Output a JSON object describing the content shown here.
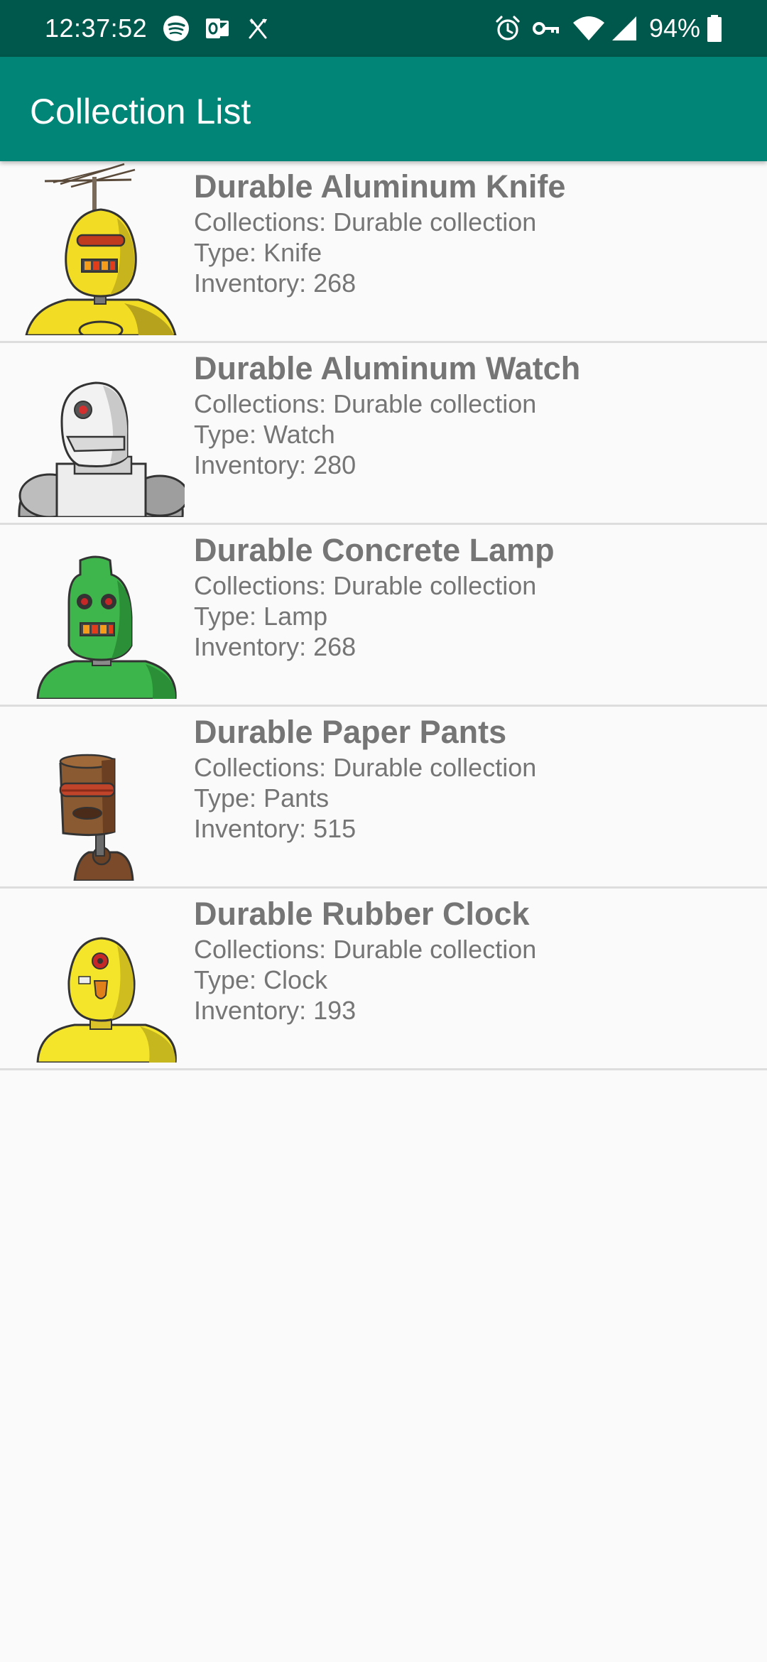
{
  "status_bar": {
    "time": "12:37:52",
    "battery": "94%",
    "left_icons": [
      "spotify-icon",
      "outlook-icon",
      "crossed-tools-icon"
    ],
    "right_icons": [
      "alarm-icon",
      "vpn-key-icon",
      "wifi-icon",
      "cell-signal-icon",
      "battery-icon"
    ]
  },
  "app_bar": {
    "title": "Collection List",
    "color": "#008577"
  },
  "items": [
    {
      "title": "Durable Aluminum Knife",
      "collections": "Collections: Durable collection",
      "type": "Type: Knife",
      "inventory": "Inventory: 268",
      "image": "yellow-antenna-robot-image"
    },
    {
      "title": "Durable Aluminum Watch",
      "collections": "Collections: Durable collection",
      "type": "Type: Watch",
      "inventory": "Inventory: 280",
      "image": "white-robot-image"
    },
    {
      "title": "Durable Concrete Lamp",
      "collections": "Collections: Durable collection",
      "type": "Type: Lamp",
      "inventory": "Inventory: 268",
      "image": "green-robot-image"
    },
    {
      "title": "Durable Paper Pants",
      "collections": "Collections: Durable collection",
      "type": "Type: Pants",
      "inventory": "Inventory: 515",
      "image": "brown-robot-image"
    },
    {
      "title": "Durable Rubber Clock",
      "collections": "Collections: Durable collection",
      "type": "Type: Clock",
      "inventory": "Inventory: 193",
      "image": "yellow-robot-image"
    }
  ]
}
